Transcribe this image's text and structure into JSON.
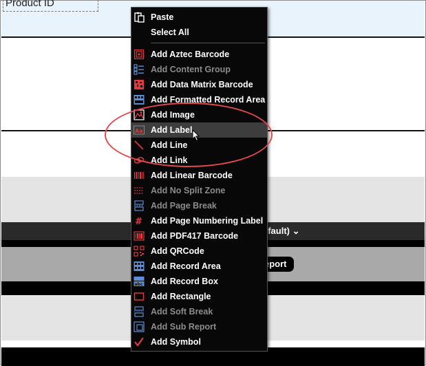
{
  "background": {
    "product_field": "Product ID",
    "group_select": "efault)",
    "report_button": "eport"
  },
  "menu": {
    "items": [
      {
        "label": "Paste",
        "enabled": true,
        "icon": "paste-icon"
      },
      {
        "label": "Select All",
        "enabled": true,
        "icon": "none"
      },
      {
        "label": "Add Aztec Barcode",
        "enabled": true,
        "icon": "aztec-barcode-icon"
      },
      {
        "label": "Add Content Group",
        "enabled": false,
        "icon": "content-group-icon"
      },
      {
        "label": "Add Data Matrix Barcode",
        "enabled": true,
        "icon": "data-matrix-barcode-icon"
      },
      {
        "label": "Add Formatted Record Area",
        "enabled": true,
        "icon": "formatted-record-area-icon"
      },
      {
        "label": "Add Image",
        "enabled": true,
        "icon": "image-icon"
      },
      {
        "label": "Add Label",
        "enabled": true,
        "icon": "label-icon",
        "hovered": true
      },
      {
        "label": "Add Line",
        "enabled": true,
        "icon": "line-icon"
      },
      {
        "label": "Add Link",
        "enabled": true,
        "icon": "link-icon"
      },
      {
        "label": "Add Linear Barcode",
        "enabled": true,
        "icon": "linear-barcode-icon"
      },
      {
        "label": "Add No Split Zone",
        "enabled": false,
        "icon": "no-split-zone-icon"
      },
      {
        "label": "Add Page Break",
        "enabled": false,
        "icon": "page-break-icon"
      },
      {
        "label": "Add Page Numbering Label",
        "enabled": true,
        "icon": "page-numbering-icon"
      },
      {
        "label": "Add PDF417 Barcode",
        "enabled": true,
        "icon": "pdf417-barcode-icon"
      },
      {
        "label": "Add QRCode",
        "enabled": true,
        "icon": "qrcode-icon"
      },
      {
        "label": "Add Record Area",
        "enabled": true,
        "icon": "record-area-icon"
      },
      {
        "label": "Add Record Box",
        "enabled": true,
        "icon": "record-box-icon"
      },
      {
        "label": "Add Rectangle",
        "enabled": true,
        "icon": "rectangle-icon"
      },
      {
        "label": "Add Soft Break",
        "enabled": false,
        "icon": "soft-break-icon"
      },
      {
        "label": "Add Sub Report",
        "enabled": false,
        "icon": "sub-report-icon"
      },
      {
        "label": "Add Symbol",
        "enabled": true,
        "icon": "symbol-icon"
      }
    ]
  },
  "colors": {
    "menu_bg": "#080808",
    "hover_bg": "#3d3d3d",
    "disabled_text": "#8c8c8c",
    "icon_red": "#e0393e",
    "icon_blue": "#5b8ed6",
    "callout_red": "#e4484c"
  }
}
